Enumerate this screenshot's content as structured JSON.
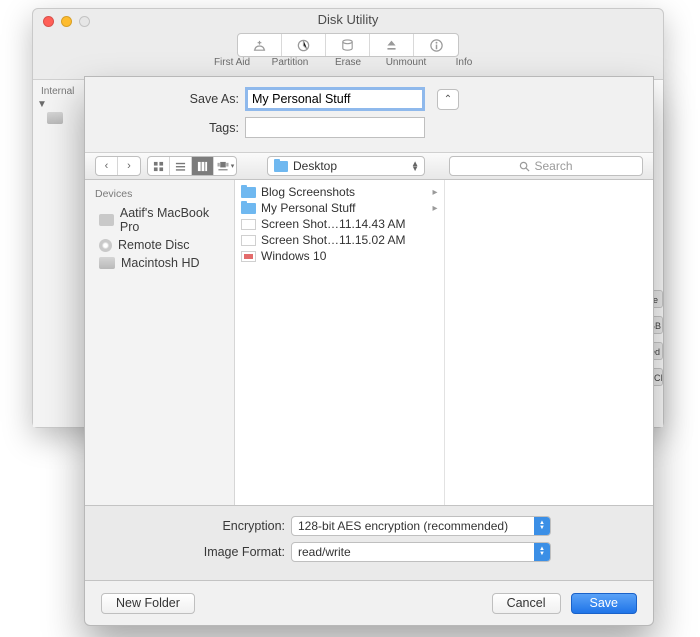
{
  "parentWindow": {
    "title": "Disk Utility",
    "toolbar": [
      "First Aid",
      "Partition",
      "Erase",
      "Unmount",
      "Info"
    ],
    "sidebarHeader": "Internal",
    "infoStrip": [
      "ne",
      "GB",
      "led",
      "PCI"
    ]
  },
  "sheet": {
    "saveAs": {
      "label": "Save As:",
      "value": "My Personal Stuff"
    },
    "tags": {
      "label": "Tags:",
      "value": ""
    },
    "location": "Desktop",
    "searchPlaceholder": "Search",
    "devicesHeader": "Devices",
    "devices": [
      {
        "name": "Aatif's MacBook Pro",
        "type": "laptop"
      },
      {
        "name": "Remote Disc",
        "type": "disc"
      },
      {
        "name": "Macintosh HD",
        "type": "hdd"
      }
    ],
    "files": [
      {
        "name": "Blog Screenshots",
        "type": "folder",
        "hasChildren": true
      },
      {
        "name": "My Personal Stuff",
        "type": "folder",
        "hasChildren": true
      },
      {
        "name": "Screen Shot…11.14.43 AM",
        "type": "image",
        "hasChildren": false
      },
      {
        "name": "Screen Shot…11.15.02 AM",
        "type": "image",
        "hasChildren": false
      },
      {
        "name": "Windows 10",
        "type": "dmg",
        "hasChildren": false
      }
    ],
    "encryption": {
      "label": "Encryption:",
      "value": "128-bit AES encryption (recommended)"
    },
    "imageFormat": {
      "label": "Image Format:",
      "value": "read/write"
    },
    "buttons": {
      "newFolder": "New Folder",
      "cancel": "Cancel",
      "save": "Save"
    }
  }
}
